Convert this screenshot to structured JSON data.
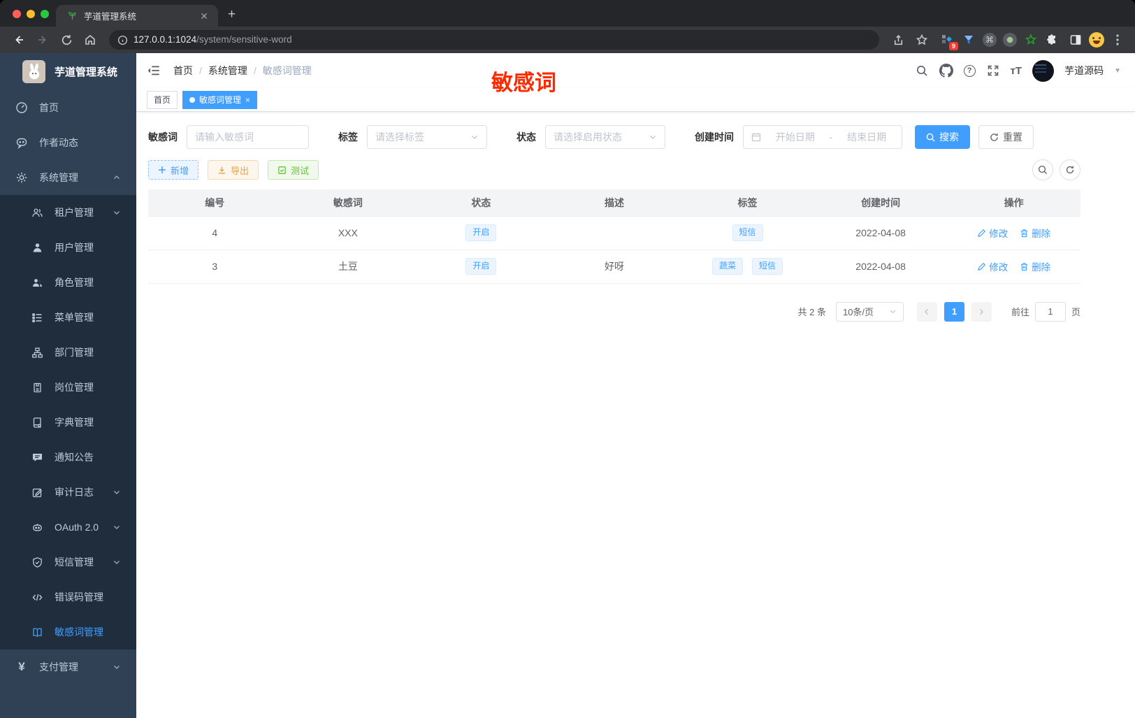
{
  "colors": {
    "accent": "#409eff",
    "success": "#67c23a",
    "warning": "#e6a23c",
    "annotation_red": "#ff2b00",
    "sidebar_bg": "#304156",
    "submenu_bg": "#1f2d3d"
  },
  "icons": {
    "favicon": "seedling",
    "traffic": "close/minimize/zoom",
    "omnibox_left": "info-circle",
    "nav_right": "search, github, help, fullscreen, font-size, caret-down",
    "row_actions": "pencil-edit, trash-delete"
  },
  "browser": {
    "tab_title": "芋道管理系统",
    "url_host": "127.0.0.1:1024",
    "url_path": "/system/sensitive-word",
    "ext_badge": "9"
  },
  "sidebar": {
    "title": "芋道管理系统",
    "items": [
      {
        "label": "首页"
      },
      {
        "label": "作者动态"
      },
      {
        "label": "系统管理"
      },
      {
        "label": "租户管理"
      },
      {
        "label": "用户管理"
      },
      {
        "label": "角色管理"
      },
      {
        "label": "菜单管理"
      },
      {
        "label": "部门管理"
      },
      {
        "label": "岗位管理"
      },
      {
        "label": "字典管理"
      },
      {
        "label": "通知公告"
      },
      {
        "label": "审计日志"
      },
      {
        "label": "OAuth 2.0"
      },
      {
        "label": "短信管理"
      },
      {
        "label": "错误码管理"
      },
      {
        "label": "敏感词管理"
      },
      {
        "label": "支付管理"
      }
    ]
  },
  "navbar": {
    "breadcrumb": [
      "首页",
      "系统管理",
      "敏感词管理"
    ],
    "annotation": "敏感词",
    "username": "芋道源码"
  },
  "tags": {
    "items": [
      {
        "label": "首页"
      },
      {
        "label": "敏感词管理"
      }
    ]
  },
  "filters": {
    "keyword_label": "敏感词",
    "keyword_placeholder": "请输入敏感词",
    "tag_label": "标签",
    "tag_placeholder": "请选择标签",
    "status_label": "状态",
    "status_placeholder": "请选择启用状态",
    "time_label": "创建时间",
    "start_placeholder": "开始日期",
    "range_sep": "-",
    "end_placeholder": "结束日期",
    "search_btn": "搜索",
    "reset_btn": "重置"
  },
  "actions": {
    "add": "新增",
    "export": "导出",
    "test": "测试"
  },
  "table": {
    "headers": [
      "编号",
      "敏感词",
      "状态",
      "描述",
      "标签",
      "创建时间",
      "操作"
    ],
    "rows": [
      {
        "id": "4",
        "word": "XXX",
        "status": "开启",
        "desc": "",
        "tags": [
          "短信"
        ],
        "created": "2022-04-08"
      },
      {
        "id": "3",
        "word": "土豆",
        "status": "开启",
        "desc": "好呀",
        "tags": [
          "蔬菜",
          "短信"
        ],
        "created": "2022-04-08"
      }
    ],
    "edit": "修改",
    "delete": "删除"
  },
  "pagination": {
    "total": "共 2 条",
    "size": "10条/页",
    "page": "1",
    "goto_label": "前往",
    "goto_value": "1",
    "unit": "页"
  }
}
